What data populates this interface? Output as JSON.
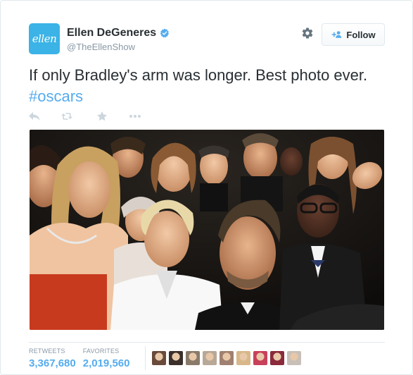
{
  "user": {
    "avatar_text": "ellen",
    "full_name": "Ellen DeGeneres",
    "handle": "@TheEllenShow",
    "verified": true
  },
  "header": {
    "settings_icon": "gear-icon",
    "follow_label": "Follow",
    "follow_icon": "add-user-icon"
  },
  "tweet": {
    "text": "If only Bradley's arm was longer. Best photo ever. ",
    "hashtag": "#oscars"
  },
  "actions": [
    {
      "name": "reply",
      "icon": "reply-icon"
    },
    {
      "name": "retweet",
      "icon": "retweet-icon"
    },
    {
      "name": "favorite",
      "icon": "star-icon"
    },
    {
      "name": "more",
      "icon": "more-icon"
    }
  ],
  "media": {
    "description_icon": "photo"
  },
  "stats": {
    "retweets_label": "RETWEETS",
    "retweets_value": "3,367,680",
    "favorites_label": "FAVORITES",
    "favorites_value": "2,019,560"
  },
  "favoriters": [
    {
      "color": "#6a4a3a"
    },
    {
      "color": "#3a2f2a"
    },
    {
      "color": "#8a7a6a"
    },
    {
      "color": "#b8a898"
    },
    {
      "color": "#a08070"
    },
    {
      "color": "#d8b88a"
    },
    {
      "color": "#c8405a"
    },
    {
      "color": "#8a2a3a"
    },
    {
      "color": "#c8c0b8"
    }
  ],
  "colors": {
    "accent": "#55acee",
    "avatar_bg": "#3bb3e6",
    "muted": "#8899a6"
  }
}
